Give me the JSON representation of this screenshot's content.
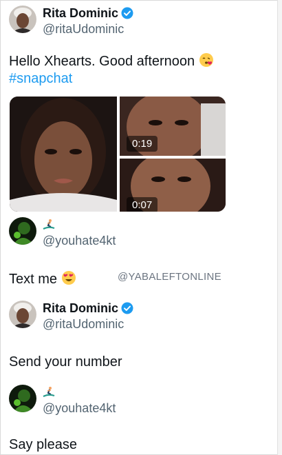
{
  "post1": {
    "display_name": "Rita Dominic",
    "handle": "@ritaUdominic",
    "text": "Hello Xhearts. Good afternoon",
    "hashtag": "#snapchat",
    "media": [
      {
        "kind": "photo"
      },
      {
        "kind": "video",
        "duration": "0:19"
      },
      {
        "kind": "video",
        "duration": "0:07"
      }
    ]
  },
  "reply1": {
    "handle": "@youhate4kt",
    "badge_icon": "surfer-emoji-icon",
    "text": "Text me"
  },
  "watermark": "@YABALEFTONLINE",
  "reply2": {
    "display_name": "Rita Dominic",
    "handle": "@ritaUdominic",
    "text": "Send your number"
  },
  "reply3": {
    "handle": "@youhate4kt",
    "badge_icon": "surfer-emoji-icon",
    "text": "Say please"
  },
  "colors": {
    "text": "#0f1419",
    "muted": "#536471",
    "link": "#1d9bf0",
    "verified": "#1d9bf0"
  }
}
